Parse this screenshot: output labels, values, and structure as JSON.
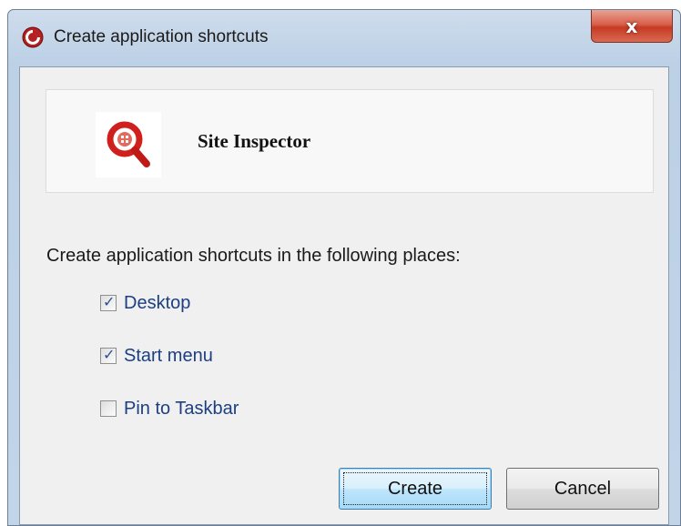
{
  "window": {
    "title": "Create application shortcuts",
    "close_symbol": "x",
    "title_icon": "app-logo-icon"
  },
  "app": {
    "name": "Site Inspector",
    "icon": "magnifier-icon"
  },
  "instruction": "Create application shortcuts in the following places:",
  "options": [
    {
      "label": "Desktop",
      "checked": true
    },
    {
      "label": "Start menu",
      "checked": true
    },
    {
      "label": "Pin to Taskbar",
      "checked": false
    }
  ],
  "buttons": {
    "create": "Create",
    "cancel": "Cancel"
  },
  "colors": {
    "accent": "#3c7fb1",
    "option_text": "#1c3f84",
    "icon_red": "#d0201e"
  }
}
